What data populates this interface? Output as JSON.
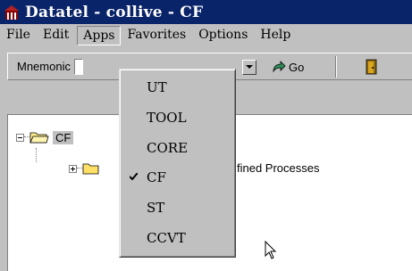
{
  "window": {
    "title": "Datatel - collive - CF",
    "accent": "#0a246a",
    "icon": "datatel-app-icon"
  },
  "menubar": {
    "items": [
      {
        "label": "File"
      },
      {
        "label": "Edit"
      },
      {
        "label": "Apps",
        "open": true
      },
      {
        "label": "Favorites"
      },
      {
        "label": "Options"
      },
      {
        "label": "Help"
      }
    ]
  },
  "toolbar": {
    "mnemonic_label": "Mnemonic",
    "mnemonic_value": "",
    "go_label": "Go",
    "go_icon": "go-arrow-icon",
    "exit_icon": "door-icon"
  },
  "tree": {
    "root_label": "CF",
    "child_label": "fined Processes"
  },
  "apps_menu": {
    "items": [
      {
        "label": "UT",
        "checked": false
      },
      {
        "label": "TOOL",
        "checked": false
      },
      {
        "label": "CORE",
        "checked": false
      },
      {
        "label": "CF",
        "checked": true
      },
      {
        "label": "ST",
        "checked": false
      },
      {
        "label": "CCVT",
        "checked": false
      }
    ]
  }
}
